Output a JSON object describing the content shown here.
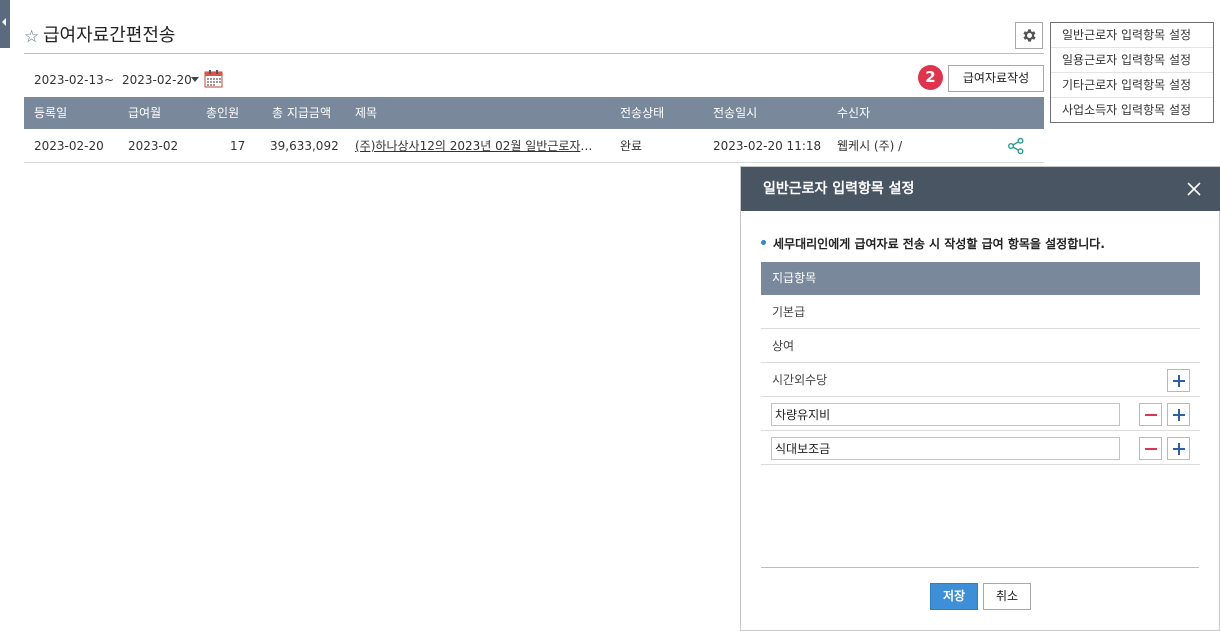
{
  "page": {
    "title": "급여자료간편전송",
    "star_icon": "star-outline-icon"
  },
  "filter": {
    "date_from": "2023-02-13",
    "separator": "~",
    "date_to": "2023-02-20"
  },
  "toolbar": {
    "step_badge": "2",
    "write_label": "급여자료작성"
  },
  "settings_menu": {
    "items": [
      "일반근로자 입력항목 설정",
      "일용근로자 입력항목 설정",
      "기타근로자 입력항목 설정",
      "사업소득자 입력항목 설정"
    ]
  },
  "table": {
    "headers": [
      "등록일",
      "급여월",
      "총인원",
      "총 지급금액",
      "제목",
      "전송상태",
      "전송일시",
      "수신자"
    ],
    "rows": [
      {
        "reg_date": "2023-02-20",
        "pay_month": "2023-02",
        "headcount": "17",
        "total_amount": "39,633,092",
        "title": "(주)하나상사12의 2023년 02월 일반근로자 급여자료",
        "status": "완료",
        "sent_at": "2023-02-20 11:18",
        "receiver": "웹케시 (주) /"
      }
    ]
  },
  "modal": {
    "title": "일반근로자 입력항목 설정",
    "description": "세무대리인에게 급여자료 전송 시 작성할 급여 항목을 설정합니다.",
    "column_header": "지급항목",
    "fixed_items": [
      "기본급",
      "상여",
      "시간외수당"
    ],
    "custom_items": [
      "차량유지비",
      "식대보조금"
    ],
    "save_label": "저장",
    "cancel_label": "취소"
  },
  "colors": {
    "header_bar": "#7a889c",
    "modal_header": "#4a5564",
    "badge": "#e0344c",
    "primary": "#3d8fd8",
    "minus": "#d9374b",
    "plus": "#2c5fa6",
    "share_icon": "#2a9d8f"
  }
}
